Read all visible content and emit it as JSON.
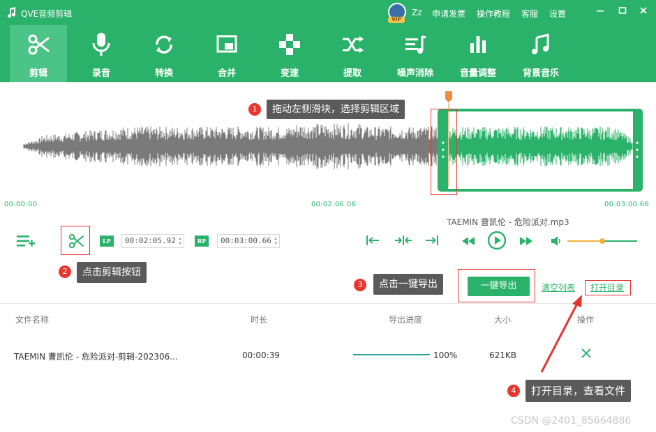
{
  "window": {
    "title": "QVE音频剪辑",
    "user_name": "Zz",
    "vip": "VIP",
    "menu": [
      "申请发票",
      "操作教程",
      "客服",
      "设置"
    ]
  },
  "toolbar": {
    "tools": [
      {
        "label": "剪辑",
        "icon": "scissors-icon",
        "active": true
      },
      {
        "label": "录音",
        "icon": "microphone-icon"
      },
      {
        "label": "转换",
        "icon": "convert-icon"
      },
      {
        "label": "合并",
        "icon": "merge-icon"
      },
      {
        "label": "变速",
        "icon": "speed-icon"
      },
      {
        "label": "提取",
        "icon": "shuffle-icon"
      },
      {
        "label": "噪声消除",
        "icon": "noise-icon"
      },
      {
        "label": "音量调整",
        "icon": "volume-bars-icon"
      },
      {
        "label": "背景音乐",
        "icon": "music-note-icon"
      }
    ]
  },
  "timeline": {
    "start": "00:00:00",
    "middle": "00:02:06.06",
    "end": "00:03:00.66"
  },
  "player": {
    "filename": "TAEMIN 曹凯伦 - 危险派对.mp3",
    "lp_label": "LP",
    "lp_value": "00:02:05.92",
    "rp_label": "RP",
    "rp_value": "00:03:00.66",
    "volume_level": 0.5
  },
  "tips": {
    "t1": {
      "num": "1",
      "text": "拖动左侧滑块，选择剪辑区域"
    },
    "t2": {
      "num": "2",
      "text": "点击剪辑按钮"
    },
    "t3": {
      "num": "3",
      "text": "点击一键导出"
    },
    "t4": {
      "num": "4",
      "text": "打开目录，查看文件"
    }
  },
  "actions": {
    "export": "一键导出",
    "clear_list": "清空列表",
    "open_dir": "打开目录"
  },
  "file_list": {
    "headers": [
      "文件名称",
      "时长",
      "导出进度",
      "大小",
      "操作"
    ],
    "rows": [
      {
        "name": "TAEMIN 曹凯伦 - 危险派对-剪辑-202306...",
        "duration": "00:00:39",
        "progress": 1.0,
        "progress_text": "100%",
        "size": "621KB"
      }
    ]
  },
  "watermark": "CSDN @2401_85664886",
  "colors": {
    "accent": "#2bb26a",
    "tool_active": "#4cc487",
    "wave_gray": "#7a7a7a",
    "marker": "#f08a3c",
    "tip_red": "#e8352f"
  }
}
